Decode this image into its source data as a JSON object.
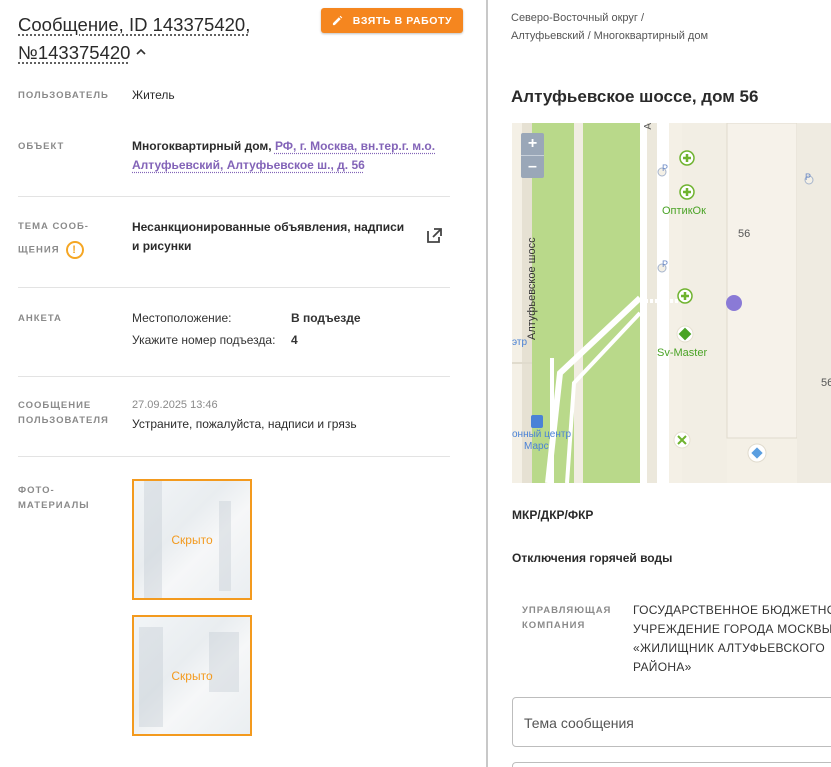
{
  "header": {
    "title": "Сообщение, ID 143375420, №143375420",
    "take_button_label": "ВЗЯТЬ В РАБОТУ"
  },
  "fields": {
    "user_label": "ПОЛЬЗОВАТЕЛЬ",
    "user_value": "Житель",
    "object_label": "ОБЪЕКТ",
    "object_prefix": "Многоквартирный дом,",
    "object_link": "РФ, г. Москва, вн.тер.г. м.о. Алтуфьевский, Алтуфьевское ш., д. 56",
    "topic_label_1": "ТЕМА СООБ-",
    "topic_label_2": "ЩЕНИЯ",
    "topic_value": "Несанкционированные объявления, надписи и рисунки",
    "form_label": "АНКЕТА",
    "form_items": [
      {
        "key": "Местоположение:",
        "value": "В подъезде"
      },
      {
        "key": "Укажите номер подъезда:",
        "value": "4"
      }
    ],
    "message_label": "СООБЩЕНИЕ ПОЛЬЗОВАТЕЛЯ",
    "message_timestamp": "27.09.2025 13:46",
    "message_text": "Устраните, пожалуйста, надписи и грязь",
    "photos_label": "ФОТО-МАТЕРИАЛЫ",
    "photos": [
      {
        "caption": "Скрыто"
      },
      {
        "caption": "Скрыто"
      }
    ]
  },
  "right": {
    "breadcrumb": "Северо-Восточный округ / Алтуфьевский / Многоквартирный дом",
    "address": "Алтуфьевское шоссе, дом 56",
    "map": {
      "zoom_in": "+",
      "zoom_out": "–",
      "street_label": "Алтуфьевское шосс",
      "street_label_top": "А",
      "poi_1": "ОптикОк",
      "poi_2": "Sv-Master",
      "poi_3_line1": "онный центр",
      "poi_3_line2": "Марс",
      "house_number": "56",
      "house_number_2": "56",
      "edge_text": "этр"
    },
    "mkr": "МКР/ДКР/ФКР",
    "hot_water": "Отключения горячей воды",
    "uk_label": "УПРАВЛЯЮЩАЯ КОМПАНИЯ",
    "uk_value": "ГОСУДАРСТВЕННОЕ БЮДЖЕТНОЕ УЧРЕЖДЕНИЕ ГОРОДА МОСКВЫ «ЖИЛИЩНИК АЛТУФЬЕВСКОГО РАЙОНА»",
    "subject_placeholder": "Тема сообщения"
  },
  "colors": {
    "accent": "#f5861f",
    "link": "#8364b8",
    "photo_border": "#f39a1e",
    "warning": "#f5a623"
  }
}
